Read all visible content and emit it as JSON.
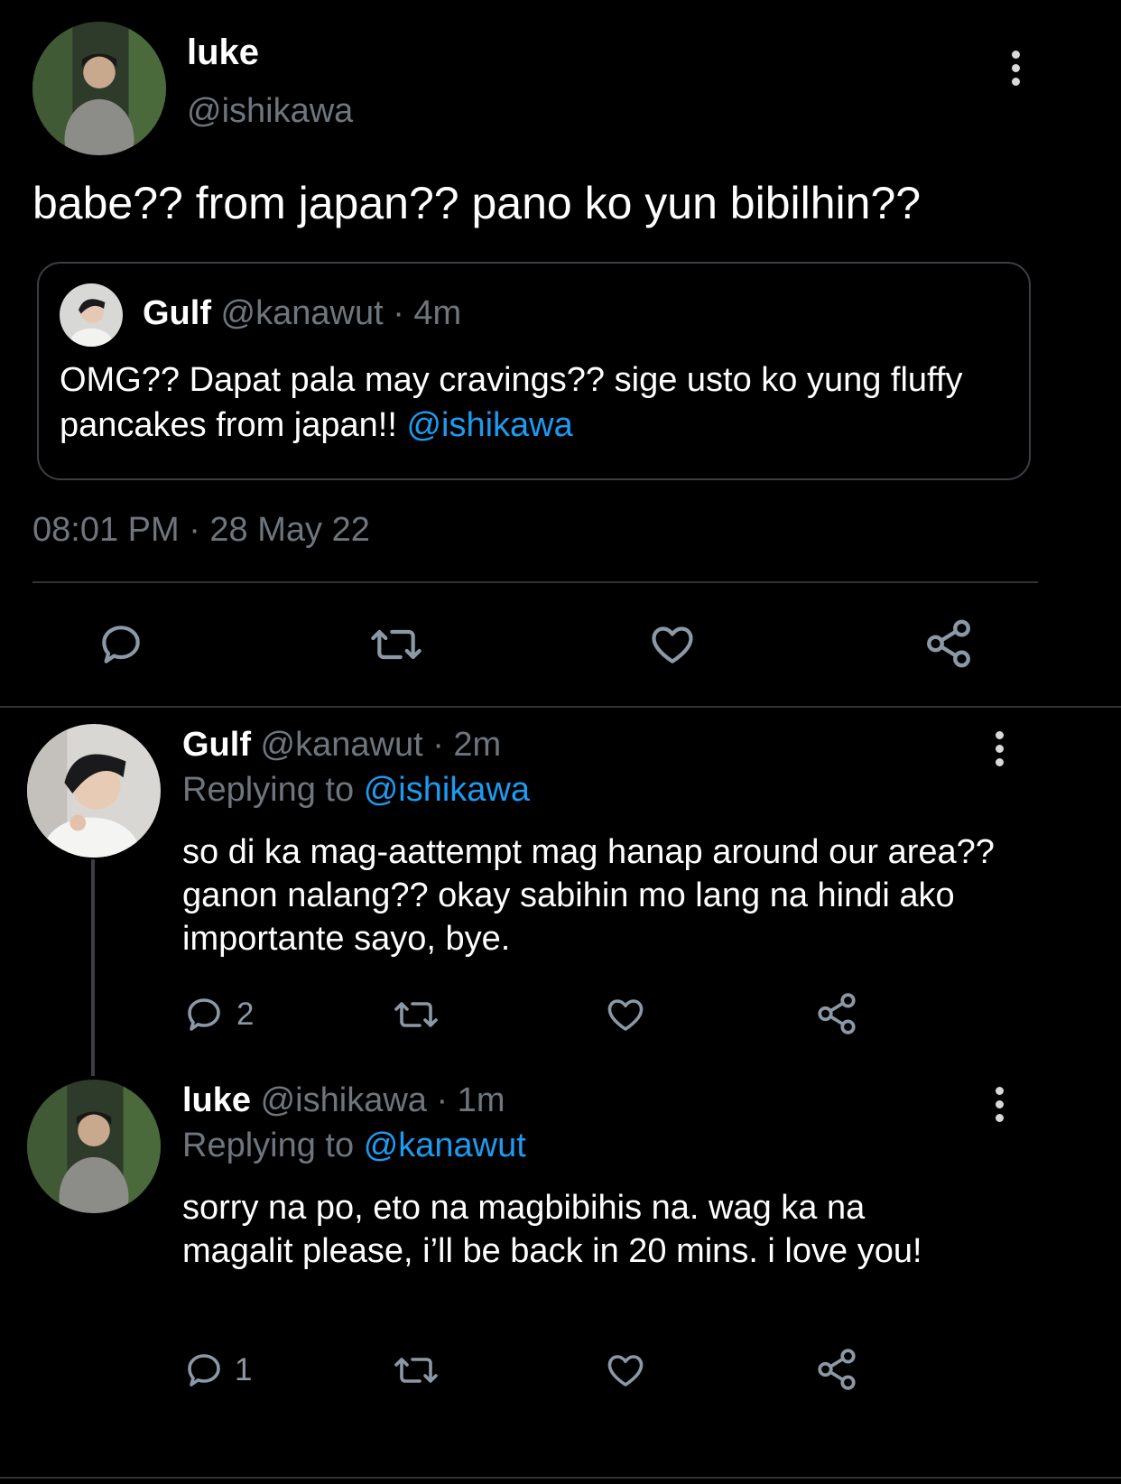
{
  "main_tweet": {
    "name": "luke",
    "handle": "@ishikawa",
    "text": "babe?? from japan?? pano ko yun bibilhin??",
    "timestamp": "08:01 PM · 28 May 22",
    "quoted": {
      "name": "Gulf",
      "handle_time": "@kanawut · 4m",
      "text": "OMG?? Dapat pala may cravings?? sige usto ko yung fluffy pancakes from japan!!",
      "mention": "@ishikawa"
    }
  },
  "replies": [
    {
      "name": "Gulf",
      "handle_time": "@kanawut · 2m",
      "replying_label": "Replying to",
      "replying_to": "@ishikawa",
      "text": "so di ka mag-aattempt mag hanap around our area?? ganon nalang?? okay sabihin mo lang na hindi ako importante sayo, bye.",
      "reply_count": "2"
    },
    {
      "name": "luke",
      "handle_time": "@ishikawa · 1m",
      "replying_label": "Replying to",
      "replying_to": "@kanawut",
      "text": "sorry na po, eto na magbibihis na. wag ka na magalit please, i’ll be back in 20 mins. i love you!",
      "reply_count": "1"
    }
  ],
  "colors": {
    "background": "#000000",
    "text": "#ffffff",
    "secondary": "#6e767d",
    "link": "#1d9bf0",
    "divider": "#2f3336"
  },
  "icons": [
    "more-icon",
    "reply-icon",
    "retweet-icon",
    "like-icon",
    "share-icon"
  ]
}
